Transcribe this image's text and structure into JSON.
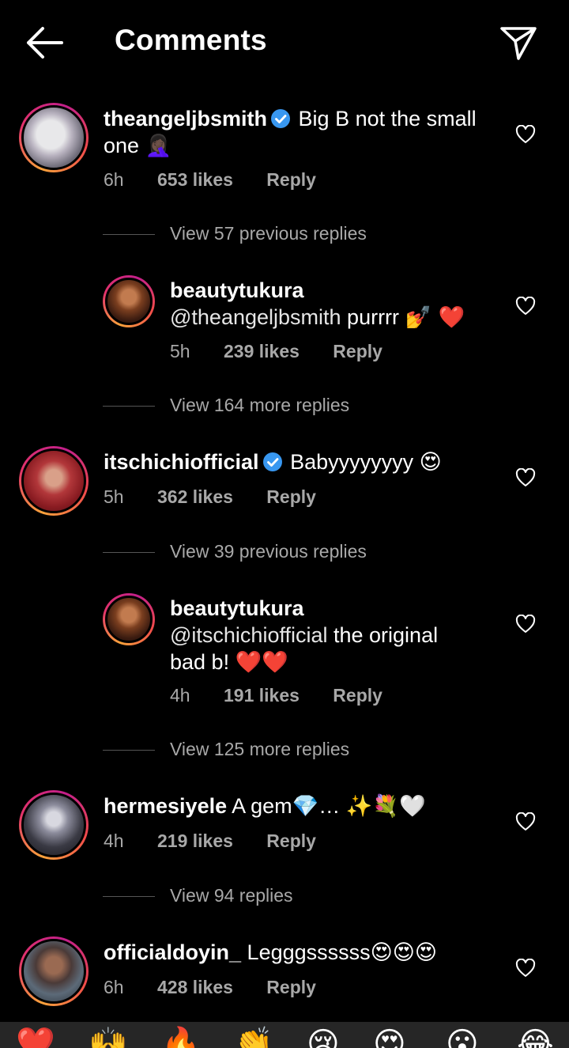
{
  "header": {
    "title": "Comments"
  },
  "colors": {
    "background": "#000000",
    "secondary_text": "#a8a8a8",
    "verified": "#3897f0",
    "heart_red": "#e0162b"
  },
  "comments": [
    {
      "username": "theangeljbsmith",
      "verified": true,
      "text": "Big B not the small",
      "text2": "one",
      "emoji": "🤦🏿‍♀️",
      "time": "6h",
      "likes": "653 likes",
      "reply": "Reply"
    },
    {
      "username": "beautytukura",
      "mention": "@theangeljbsmith",
      "text": "purrrr",
      "emoji": "💅 ❤️",
      "time": "5h",
      "likes": "239 likes",
      "reply": "Reply"
    },
    {
      "username": "itschichiofficial",
      "verified": true,
      "text": "Babyyyyyyyy",
      "emoji": "😍",
      "time": "5h",
      "likes": "362 likes",
      "reply": "Reply"
    },
    {
      "username": "beautytukura",
      "mention": "@itschichiofficial",
      "text": "the original",
      "text2": "bad b!",
      "emoji": "❤️❤️",
      "time": "4h",
      "likes": "191 likes",
      "reply": "Reply"
    },
    {
      "username": "hermesiyele",
      "text": "A gem💎…",
      "emoji": "✨💐🤍",
      "time": "4h",
      "likes": "219 likes",
      "reply": "Reply"
    },
    {
      "username": "officialdoyin_",
      "text": "Legggssssss",
      "emoji": "😍😍😍",
      "time": "6h",
      "likes": "428 likes",
      "reply": "Reply"
    }
  ],
  "view_rows": [
    "View 57 previous replies",
    "View 164 more replies",
    "View 39 previous replies",
    "View 125 more replies",
    "View 94 replies"
  ],
  "emoji_bar": [
    "❤️",
    "🙌",
    "🔥",
    "👏",
    "😢",
    "😍",
    "😮",
    "😂"
  ]
}
